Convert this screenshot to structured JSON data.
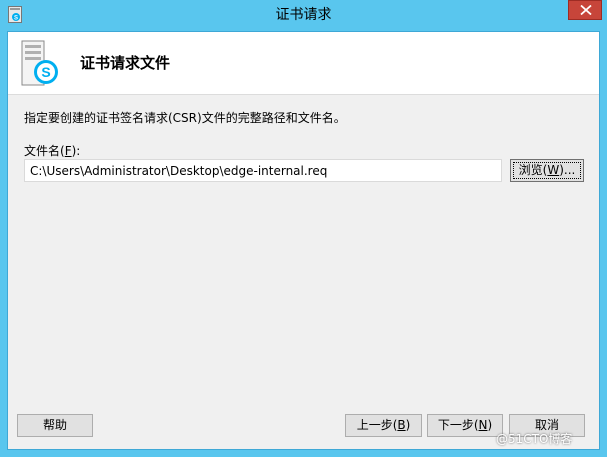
{
  "window": {
    "title": "证书请求"
  },
  "header": {
    "title": "证书请求文件"
  },
  "form": {
    "instructions": "指定要创建的证书签名请求(CSR)文件的完整路径和文件名。",
    "file_label_prefix": "文件名(",
    "file_label_accel": "F",
    "file_label_suffix": "):",
    "file_path_value": "C:\\Users\\Administrator\\Desktop\\edge-internal.req",
    "browse_label_prefix": "浏览(",
    "browse_label_accel": "W",
    "browse_label_suffix": ")..."
  },
  "footer": {
    "help_label": "帮助",
    "back_label_prefix": "上一步(",
    "back_label_accel": "B",
    "back_label_suffix": ")",
    "next_label_prefix": "下一步(",
    "next_label_accel": "N",
    "next_label_suffix": ")",
    "cancel_label": "取消"
  },
  "watermark": {
    "text": "@51CTO博客"
  },
  "colors": {
    "titlebar": "#59c6ee",
    "close_button": "#c7453a",
    "client_background": "#f0f0f0",
    "skype_blue": "#00aff0"
  },
  "icons": {
    "title": "skype-server-icon",
    "header": "server-skype-icon",
    "close": "close-icon"
  }
}
